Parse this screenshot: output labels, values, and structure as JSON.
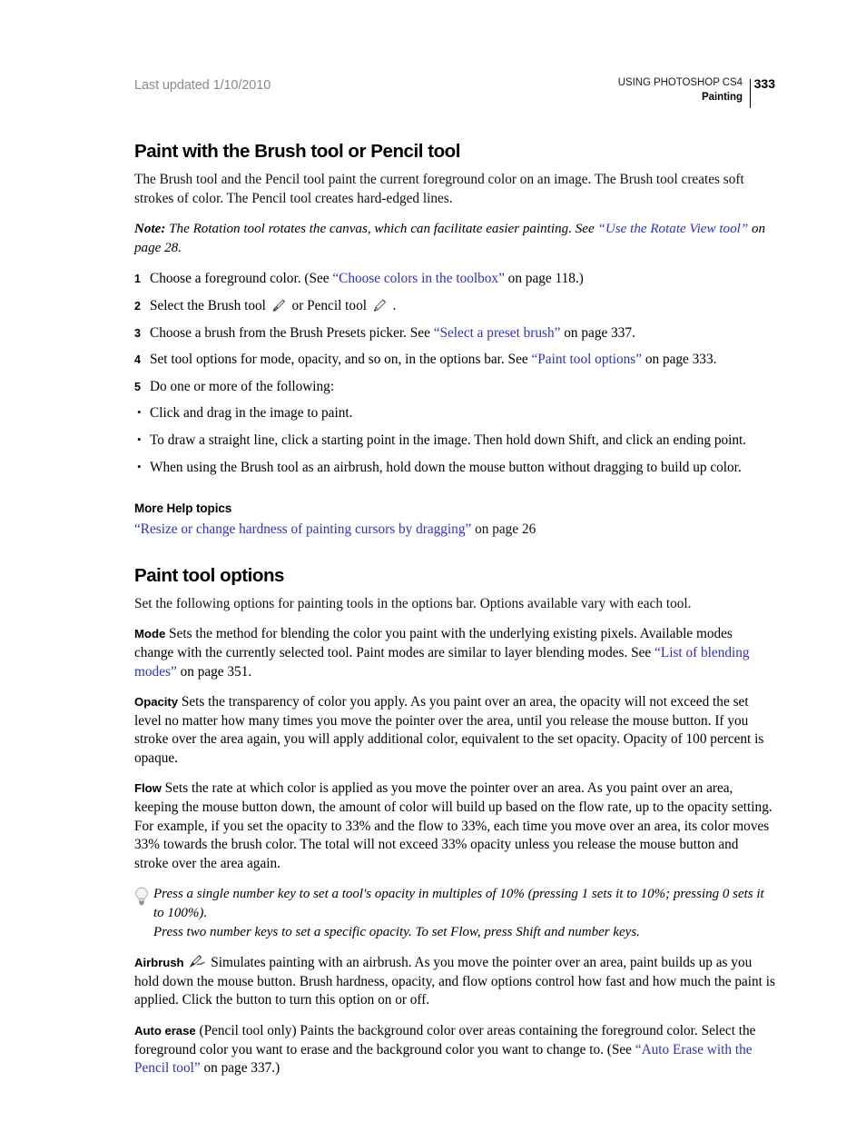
{
  "header": {
    "last_updated": "Last updated 1/10/2010",
    "book_title": "USING PHOTOSHOP CS4",
    "chapter": "Painting",
    "page_number": "333"
  },
  "section1": {
    "title": "Paint with the Brush tool or Pencil tool",
    "intro": "The Brush tool and the Pencil tool paint the current foreground color on an image. The Brush tool creates soft strokes of color. The Pencil tool creates hard-edged lines.",
    "note_label": "Note:",
    "note_text_before": " The Rotation tool rotates the canvas, which can facilitate easier painting. See ",
    "note_link": "Use the Rotate View tool",
    "note_text_after": " on page 28.",
    "steps": [
      {
        "num": "1",
        "before": "Choose a foreground color. (See ",
        "link": "Choose colors in the toolbox",
        "after": " on page 118.)"
      },
      {
        "num": "2",
        "before": "Select the Brush tool ",
        "mid": " or Pencil tool ",
        "after": " ."
      },
      {
        "num": "3",
        "before": "Choose a brush from the Brush Presets picker. See ",
        "link": "Select a preset brush",
        "after": " on page 337."
      },
      {
        "num": "4",
        "before": "Set tool options for mode, opacity, and so on, in the options bar. See ",
        "link": "Paint tool options",
        "after": " on page 333."
      },
      {
        "num": "5",
        "before": "Do one or more of the following:"
      }
    ],
    "bullets": [
      "Click and drag in the image to paint.",
      "To draw a straight line, click a starting point in the image. Then hold down Shift, and click an ending point.",
      "When using the Brush tool as an airbrush, hold down the mouse button without dragging to build up color."
    ],
    "more_help_title": "More Help topics",
    "more_help_link": "Resize or change hardness of painting cursors by dragging",
    "more_help_after": " on page 26"
  },
  "section2": {
    "title": "Paint tool options",
    "intro": "Set the following options for painting tools in the options bar. Options available vary with each tool.",
    "mode": {
      "term": "Mode",
      "before": "  Sets the method for blending the color you paint with the underlying existing pixels. Available modes change with the currently selected tool. Paint modes are similar to layer blending modes. See ",
      "link": "List of blending modes",
      "after": " on page 351."
    },
    "opacity": {
      "term": "Opacity",
      "text": "  Sets the transparency of color you apply. As you paint over an area, the opacity will not exceed the set level no matter how many times you move the pointer over the area, until you release the mouse button. If you stroke over the area again, you will apply additional color, equivalent to the set opacity. Opacity of 100 percent is opaque."
    },
    "flow": {
      "term": "Flow",
      "text": "  Sets the rate at which color is applied as you move the pointer over an area. As you paint over an area, keeping the mouse button down, the amount of color will build up based on the flow rate, up to the opacity setting. For example, if you set the opacity to 33% and the flow to 33%, each time you move over an area, its color moves 33% towards the brush color. The total will not exceed 33% opacity unless you release the mouse button and stroke over the area again."
    },
    "tip": {
      "line1": "Press a single number key to set a tool's opacity in multiples of 10% (pressing 1 sets it to 10%; pressing 0 sets it to 100%).",
      "line2": "Press two number keys to set a specific opacity. To set Flow, press Shift and number keys."
    },
    "airbrush": {
      "term": "Airbrush",
      "text": "  Simulates painting with an airbrush. As you move the pointer over an area, paint builds up as you hold down the mouse button. Brush hardness, opacity, and flow options control how fast and how much the paint is applied. Click the button to turn this option on or off."
    },
    "auto_erase": {
      "term": "Auto erase",
      "before": "  (Pencil tool only) Paints the background color over areas containing the foreground color. Select the foreground color you want to erase and the background color you want to change to. (See ",
      "link": "Auto Erase with the Pencil tool",
      "after": " on page 337.)"
    }
  },
  "colors": {
    "link": "#2f2fc4",
    "header_gray": "#8a8a8a",
    "text": "#111111"
  },
  "icons": {
    "brush": "brush-tool-icon",
    "pencil": "pencil-tool-icon",
    "airbrush": "airbrush-icon",
    "tip": "lightbulb-icon"
  }
}
